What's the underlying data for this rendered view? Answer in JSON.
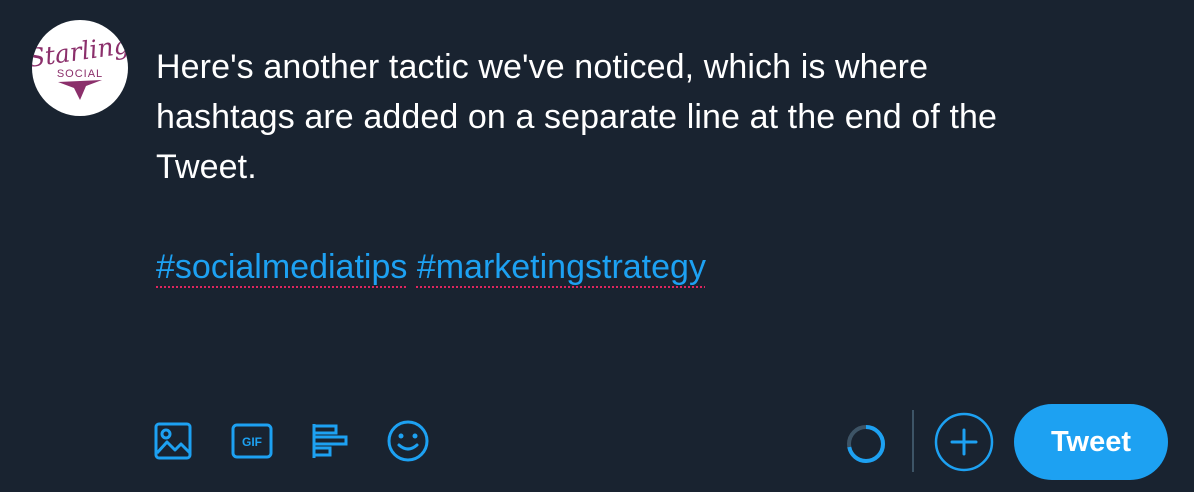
{
  "avatar": {
    "logo_text": "Starling",
    "logo_subtext": "SOCIAL",
    "brand_color": "#8b2f6b"
  },
  "tweet": {
    "lines": [
      "Here's another tactic we've noticed, which is where",
      "hashtags are added on a separate line at the end of the",
      "Tweet."
    ],
    "hashtags": [
      "#socialmediatips",
      "#marketingstrategy"
    ]
  },
  "toolbar": {
    "icons": [
      "image-icon",
      "gif-icon",
      "poll-icon",
      "emoji-icon"
    ],
    "gif_label": "GIF",
    "progress_fraction": 0.72,
    "add_icon": "plus-icon",
    "tweet_label": "Tweet"
  },
  "colors": {
    "background": "#192330",
    "accent": "#1da1f2",
    "spellcheck": "#e0245e",
    "text": "#ffffff"
  }
}
